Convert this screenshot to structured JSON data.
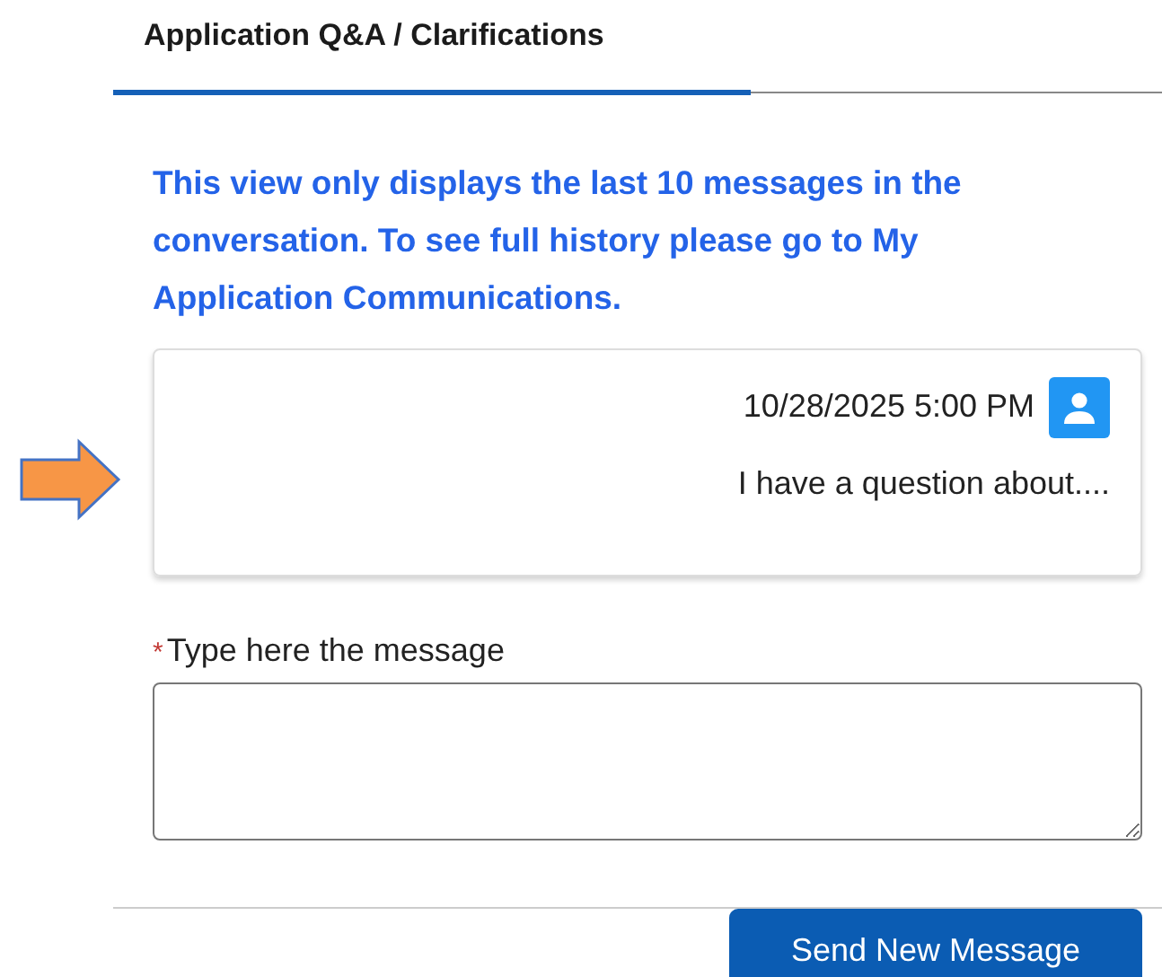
{
  "tabs": [
    {
      "label": "Application Q&A / Clarifications",
      "selected": true
    }
  ],
  "notice": "This view only displays the last 10 messages in the conversation. To see full history please go to My Application Communications.",
  "messages": [
    {
      "timestamp": "10/28/2025 5:00 PM",
      "text": "I have a question about...."
    }
  ],
  "message_field": {
    "label": "Type here the message",
    "required_mark": "*"
  },
  "buttons": [
    "Send New Message"
  ]
}
